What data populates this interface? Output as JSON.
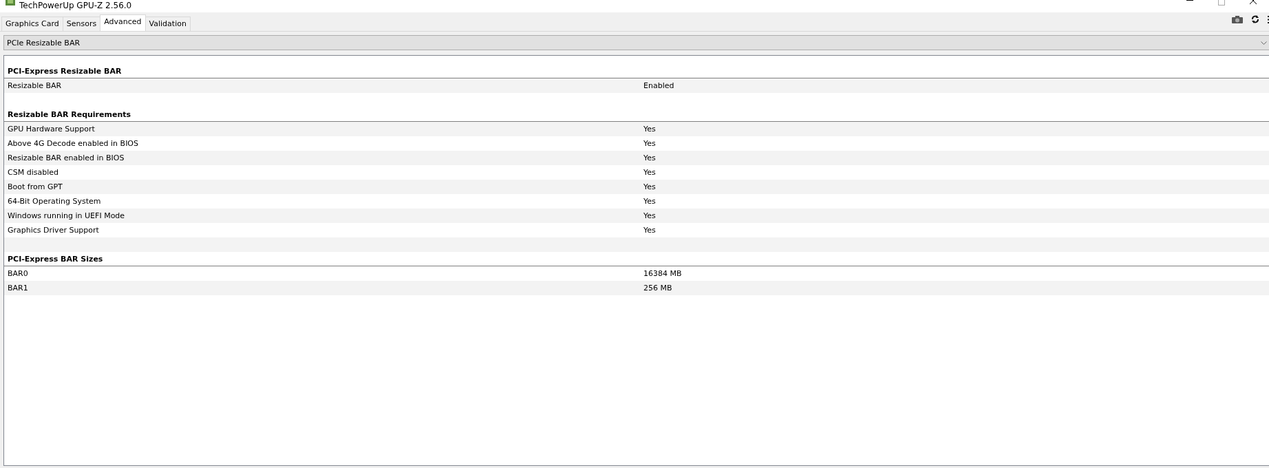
{
  "window": {
    "title": "TechPowerUp GPU-Z 2.56.0"
  },
  "tabs": [
    {
      "label": "Graphics Card",
      "selected": false
    },
    {
      "label": "Sensors",
      "selected": false
    },
    {
      "label": "Advanced",
      "selected": true
    },
    {
      "label": "Validation",
      "selected": false
    }
  ],
  "dropdown": {
    "value": "PCIe Resizable BAR"
  },
  "sections": [
    {
      "title": "PCI-Express Resizable BAR",
      "rows": [
        {
          "label": "Resizable BAR",
          "value": "Enabled"
        }
      ]
    },
    {
      "title": "Resizable BAR Requirements",
      "rows": [
        {
          "label": "GPU Hardware Support",
          "value": "Yes"
        },
        {
          "label": "Above 4G Decode enabled in BIOS",
          "value": "Yes"
        },
        {
          "label": "Resizable BAR enabled in BIOS",
          "value": "Yes"
        },
        {
          "label": "CSM disabled",
          "value": "Yes"
        },
        {
          "label": "Boot from GPT",
          "value": "Yes"
        },
        {
          "label": "64-Bit Operating System",
          "value": "Yes"
        },
        {
          "label": "Windows running in UEFI Mode",
          "value": "Yes"
        },
        {
          "label": "Graphics Driver Support",
          "value": "Yes"
        }
      ]
    },
    {
      "title": "PCI-Express BAR Sizes",
      "rows": [
        {
          "label": "BAR0",
          "value": "16384 MB"
        },
        {
          "label": "BAR1",
          "value": "256 MB"
        }
      ]
    }
  ]
}
